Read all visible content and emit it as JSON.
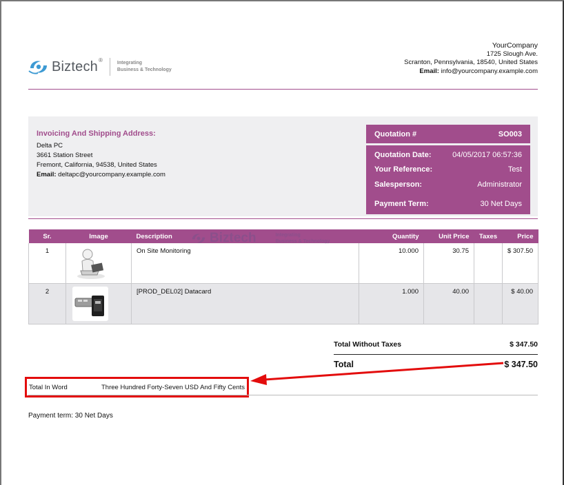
{
  "brand": {
    "logo_text": "Biztech",
    "logo_reg": "®",
    "tagline_1": "Integrating",
    "tagline_2": "Business & Technology"
  },
  "company": {
    "name": "YourCompany",
    "street": "1725 Slough Ave.",
    "city_line": "Scranton, Pennsylvania, 18540, United States",
    "email_label": "Email:",
    "email": "info@yourcompany.example.com"
  },
  "address": {
    "title": "Invoicing And Shipping Address:",
    "name": "Delta PC",
    "street": "3661 Station Street",
    "city_line": "Fremont, California, 94538, United States",
    "email_label": "Email:",
    "email": "deltapc@yourcompany.example.com"
  },
  "quotation": {
    "number_label": "Quotation #",
    "number": "SO003",
    "date_label": "Quotation Date:",
    "date": "04/05/2017 06:57:36",
    "reference_label": "Your Reference:",
    "reference": "Test",
    "salesperson_label": "Salesperson:",
    "salesperson": "Administrator",
    "payment_term_label": "Payment Term:",
    "payment_term": "30 Net Days"
  },
  "table": {
    "headers": {
      "sr": "Sr.",
      "image": "Image",
      "description": "Description",
      "quantity": "Quantity",
      "unit_price": "Unit Price",
      "taxes": "Taxes",
      "price": "Price"
    },
    "rows": [
      {
        "sr": "1",
        "image": "person-laptop-icon",
        "description": "On Site Monitoring",
        "quantity": "10.000",
        "unit_price": "30.75",
        "taxes": "",
        "price": "$ 307.50"
      },
      {
        "sr": "2",
        "image": "usb-datacard-icon",
        "description": "[PROD_DEL02] Datacard",
        "quantity": "1.000",
        "unit_price": "40.00",
        "taxes": "",
        "price": "$ 40.00"
      }
    ]
  },
  "totals": {
    "without_taxes_label": "Total Without Taxes",
    "without_taxes": "$ 347.50",
    "total_label": "Total",
    "total": "$ 347.50"
  },
  "total_in_word": {
    "label": "Total In Word",
    "value": "Three Hundred Forty-Seven USD And Fifty Cents"
  },
  "payment_note": "Payment term: 30 Net Days",
  "colors": {
    "accent": "#a14d8c",
    "panel_bg": "#efeff1",
    "row_alt": "#e6e6e9",
    "highlight": "#e30c0c",
    "logo_blue": "#3d9ad3"
  }
}
